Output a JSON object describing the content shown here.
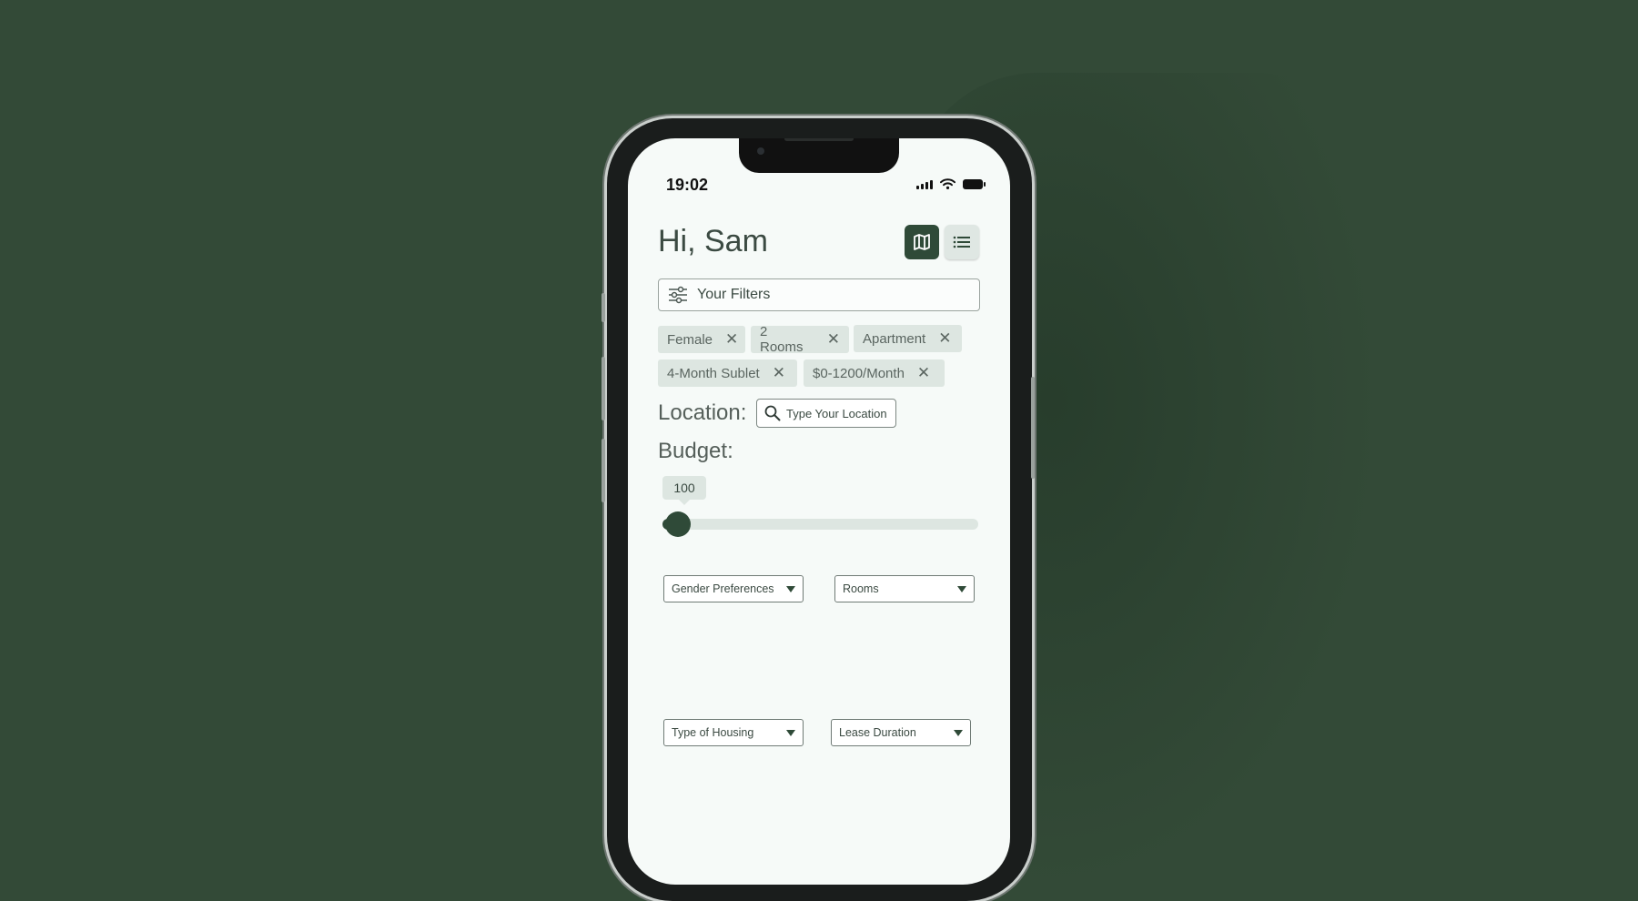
{
  "status_bar": {
    "time": "19:02",
    "icons": [
      "signal-icon",
      "wifi-icon",
      "battery-icon"
    ]
  },
  "header": {
    "greeting": "Hi, Sam",
    "view_toggle": [
      {
        "icon": "map-icon",
        "active": true
      },
      {
        "icon": "list-icon",
        "active": false
      }
    ]
  },
  "filters": {
    "label": "Your Filters",
    "icon": "sliders-icon",
    "chips": [
      "Female",
      "2 Rooms",
      "Apartment",
      "4-Month Sublet",
      "$0-1200/Month"
    ],
    "remove_icon": "close-icon",
    "remove_glyph": "✕"
  },
  "location": {
    "label": "Location:",
    "placeholder": "Type Your Location",
    "icon": "search-icon"
  },
  "budget": {
    "label": "Budget:",
    "value": "100"
  },
  "dropdowns": {
    "gender": "Gender Preferences",
    "rooms": "Rooms",
    "housing": "Type of Housing",
    "lease": "Lease Duration"
  },
  "colors": {
    "background": "#334a37",
    "accent": "#2f4a38",
    "chip": "#dde6e1",
    "screen": "#f6faf8"
  }
}
